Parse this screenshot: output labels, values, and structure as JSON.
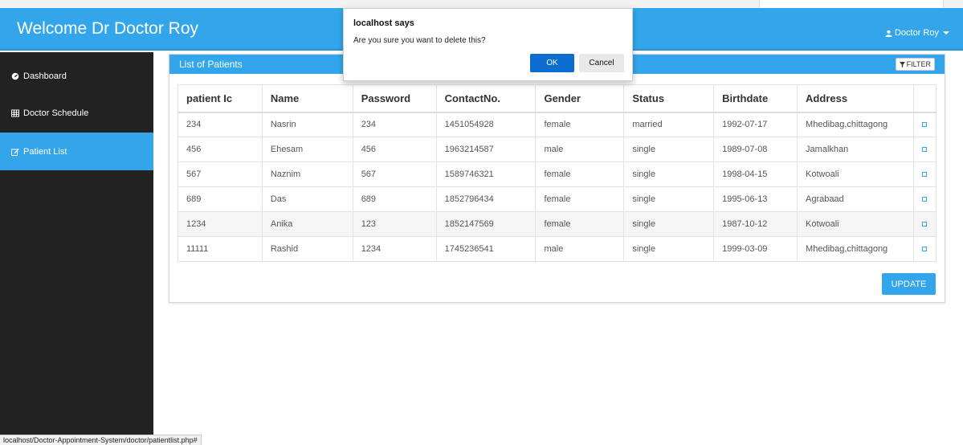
{
  "navbar": {
    "brand": "Welcome Dr Doctor Roy",
    "user_name": "Doctor Roy",
    "user_icon": "user-icon",
    "color": "#33a6eb"
  },
  "sidebar": {
    "items": [
      {
        "label": "Dashboard",
        "icon": "dashboard-icon",
        "active": false
      },
      {
        "label": "Doctor Schedule",
        "icon": "table-icon",
        "active": false
      },
      {
        "label": "Patient List",
        "icon": "edit-icon",
        "active": true
      }
    ]
  },
  "panel": {
    "title": "List of Patients",
    "filter_label": "FILTER",
    "filter_icon": "filter-icon",
    "update_label": "UPDATE"
  },
  "table": {
    "columns": [
      "patient Ic",
      "Name",
      "Password",
      "ContactNo.",
      "Gender",
      "Status",
      "Birthdate",
      "Address"
    ],
    "rows": [
      [
        "234",
        "Nasrin",
        "234",
        "1451054928",
        "female",
        "married",
        "1992-07-17",
        "Mhedibag,chittagong"
      ],
      [
        "456",
        "Ehesam",
        "456",
        "1963214587",
        "male",
        "single",
        "1989-07-08",
        "Jamalkhan"
      ],
      [
        "567",
        "Naznim",
        "567",
        "1589746321",
        "female",
        "single",
        "1998-04-15",
        "Kotwoali"
      ],
      [
        "689",
        "Das",
        "689",
        "1852796434",
        "female",
        "single",
        "1995-06-13",
        "Agrabaad"
      ],
      [
        "1234",
        "Anika",
        "123",
        "1852147569",
        "female",
        "single",
        "1987-10-12",
        "Kotwoali"
      ],
      [
        "11111",
        "Rashid",
        "1234",
        "1745236541",
        "male",
        "single",
        "1999-03-09",
        "Mhedibag,chittagong"
      ]
    ]
  },
  "dialog": {
    "title": "localhost says",
    "message": "Are you sure you want to delete this?",
    "ok_label": "OK",
    "cancel_label": "Cancel"
  },
  "status_url": "localhost/Doctor-Appointment-System/doctor/patientlist.php#"
}
